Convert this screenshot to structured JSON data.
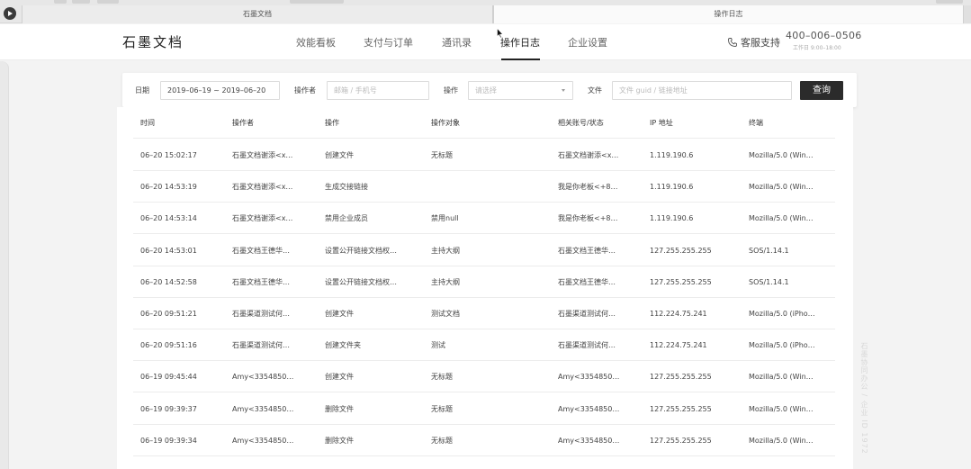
{
  "browser": {
    "tabs": [
      {
        "label": "石墨文档"
      },
      {
        "label": "操作日志"
      }
    ]
  },
  "header": {
    "logo": "石墨文档",
    "nav": [
      {
        "label": "效能看板"
      },
      {
        "label": "支付与订单"
      },
      {
        "label": "通讯录"
      },
      {
        "label": "操作日志",
        "active": true
      },
      {
        "label": "企业设置"
      }
    ],
    "support_label": "客服支持",
    "hotline": "400–006–0506",
    "hours": "工作日 9:00–18:00"
  },
  "filters": {
    "date_label": "日期",
    "date_value": "2019–06–19 ~ 2019–06–20",
    "operator_label": "操作者",
    "operator_placeholder": "邮箱 / 手机号",
    "action_label": "操作",
    "action_placeholder": "请选择",
    "file_label": "文件",
    "file_placeholder": "文件 guid / 链接地址",
    "query_label": "查询"
  },
  "table": {
    "columns": [
      "时间",
      "操作者",
      "操作",
      "操作对象",
      "相关账号/状态",
      "IP 地址",
      "终端"
    ],
    "rows": [
      [
        "06–20 15:02:17",
        "石墨文档谢添<x…",
        "创建文件",
        "无标题",
        "石墨文档谢添<x…",
        "1.119.190.6",
        "Mozilla/5.0 (Win…"
      ],
      [
        "06–20 14:53:19",
        "石墨文档谢添<x…",
        "生成交接链接",
        "",
        "我是你老板<+8…",
        "1.119.190.6",
        "Mozilla/5.0 (Win…"
      ],
      [
        "06–20 14:53:14",
        "石墨文档谢添<x…",
        "禁用企业成员",
        "禁用null",
        "我是你老板<+8…",
        "1.119.190.6",
        "Mozilla/5.0 (Win…"
      ],
      [
        "06–20 14:53:01",
        "石墨文档王德华…",
        "设置公开链接文档权…",
        "主持大纲",
        "石墨文档王德华…",
        "127.255.255.255",
        "SOS/1.14.1"
      ],
      [
        "06–20 14:52:58",
        "石墨文档王德华…",
        "设置公开链接文档权…",
        "主持大纲",
        "石墨文档王德华…",
        "127.255.255.255",
        "SOS/1.14.1"
      ],
      [
        "06–20 09:51:21",
        "石墨渠道测试何…",
        "创建文件",
        "测试文档",
        "石墨渠道测试何…",
        "112.224.75.241",
        "Mozilla/5.0 (iPho…"
      ],
      [
        "06–20 09:51:16",
        "石墨渠道测试何…",
        "创建文件夹",
        "测试",
        "石墨渠道测试何…",
        "112.224.75.241",
        "Mozilla/5.0 (iPho…"
      ],
      [
        "06–19 09:45:44",
        "Amy<3354850…",
        "创建文件",
        "无标题",
        "Amy<3354850…",
        "127.255.255.255",
        "Mozilla/5.0 (Win…"
      ],
      [
        "06–19 09:39:37",
        "Amy<3354850…",
        "删除文件",
        "无标题",
        "Amy<3354850…",
        "127.255.255.255",
        "Mozilla/5.0 (Win…"
      ],
      [
        "06–19 09:39:34",
        "Amy<3354850…",
        "删除文件",
        "无标题",
        "Amy<3354850…",
        "127.255.255.255",
        "Mozilla/5.0 (Win…"
      ]
    ]
  },
  "watermark": "石墨协同办公 / 企业 ID 1972"
}
